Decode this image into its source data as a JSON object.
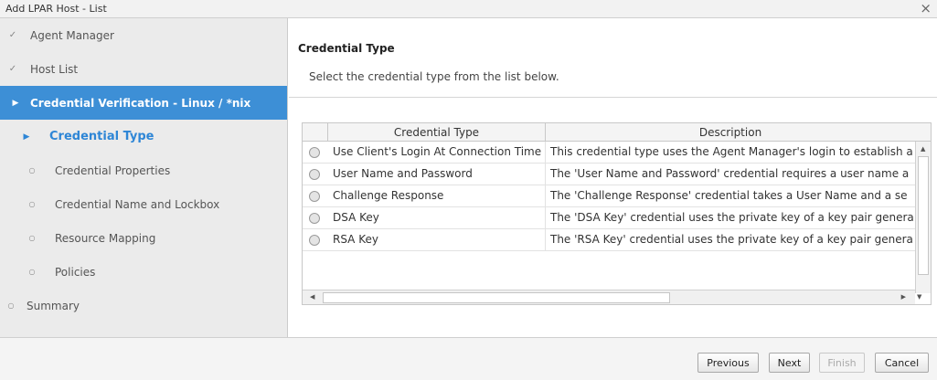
{
  "window": {
    "title": "Add LPAR Host - List",
    "close_glyph": "×"
  },
  "sidebar": {
    "items": [
      {
        "label": "Agent Manager",
        "state": "done",
        "icon": "checkmark-icon",
        "glyph": "✓"
      },
      {
        "label": "Host List",
        "state": "done",
        "icon": "checkmark-icon",
        "glyph": "✓"
      },
      {
        "label": "Credential Verification - Linux / *nix",
        "state": "active",
        "icon": "triangle-right-icon",
        "glyph": "▶"
      },
      {
        "label": "Credential Type",
        "state": "current",
        "icon": "triangle-right-icon",
        "glyph": "▶"
      },
      {
        "label": "Credential Properties",
        "state": "pending",
        "icon": "circle-icon",
        "glyph": "○"
      },
      {
        "label": "Credential Name and Lockbox",
        "state": "pending",
        "icon": "circle-icon",
        "glyph": "○"
      },
      {
        "label": "Resource Mapping",
        "state": "pending",
        "icon": "circle-icon",
        "glyph": "○"
      },
      {
        "label": "Policies",
        "state": "pending",
        "icon": "circle-icon",
        "glyph": "○"
      },
      {
        "label": "Summary",
        "state": "pending",
        "icon": "circle-icon",
        "glyph": "○"
      }
    ]
  },
  "main": {
    "heading": "Credential Type",
    "instructions": "Select the credential type from the list below.",
    "table": {
      "columns": [
        "Credential Type",
        "Description"
      ],
      "rows": [
        {
          "type": "Use Client's Login At Connection Time",
          "description": "This credential type uses the Agent Manager's login to establish a"
        },
        {
          "type": "User Name and Password",
          "description": "The 'User Name and Password' credential requires a user name a"
        },
        {
          "type": "Challenge Response",
          "description": "The 'Challenge Response' credential takes a User Name and a se"
        },
        {
          "type": "DSA Key",
          "description": "The 'DSA Key' credential uses the private key of a key pair genera"
        },
        {
          "type": "RSA Key",
          "description": "The 'RSA Key' credential uses the private key of a key pair genera"
        }
      ]
    }
  },
  "footer": {
    "previous": "Previous",
    "next": "Next",
    "finish": "Finish",
    "cancel": "Cancel"
  },
  "colors": {
    "accent": "#3d8fd6",
    "current_step": "#2e86d6",
    "sidebar_bg": "#ebebeb"
  }
}
